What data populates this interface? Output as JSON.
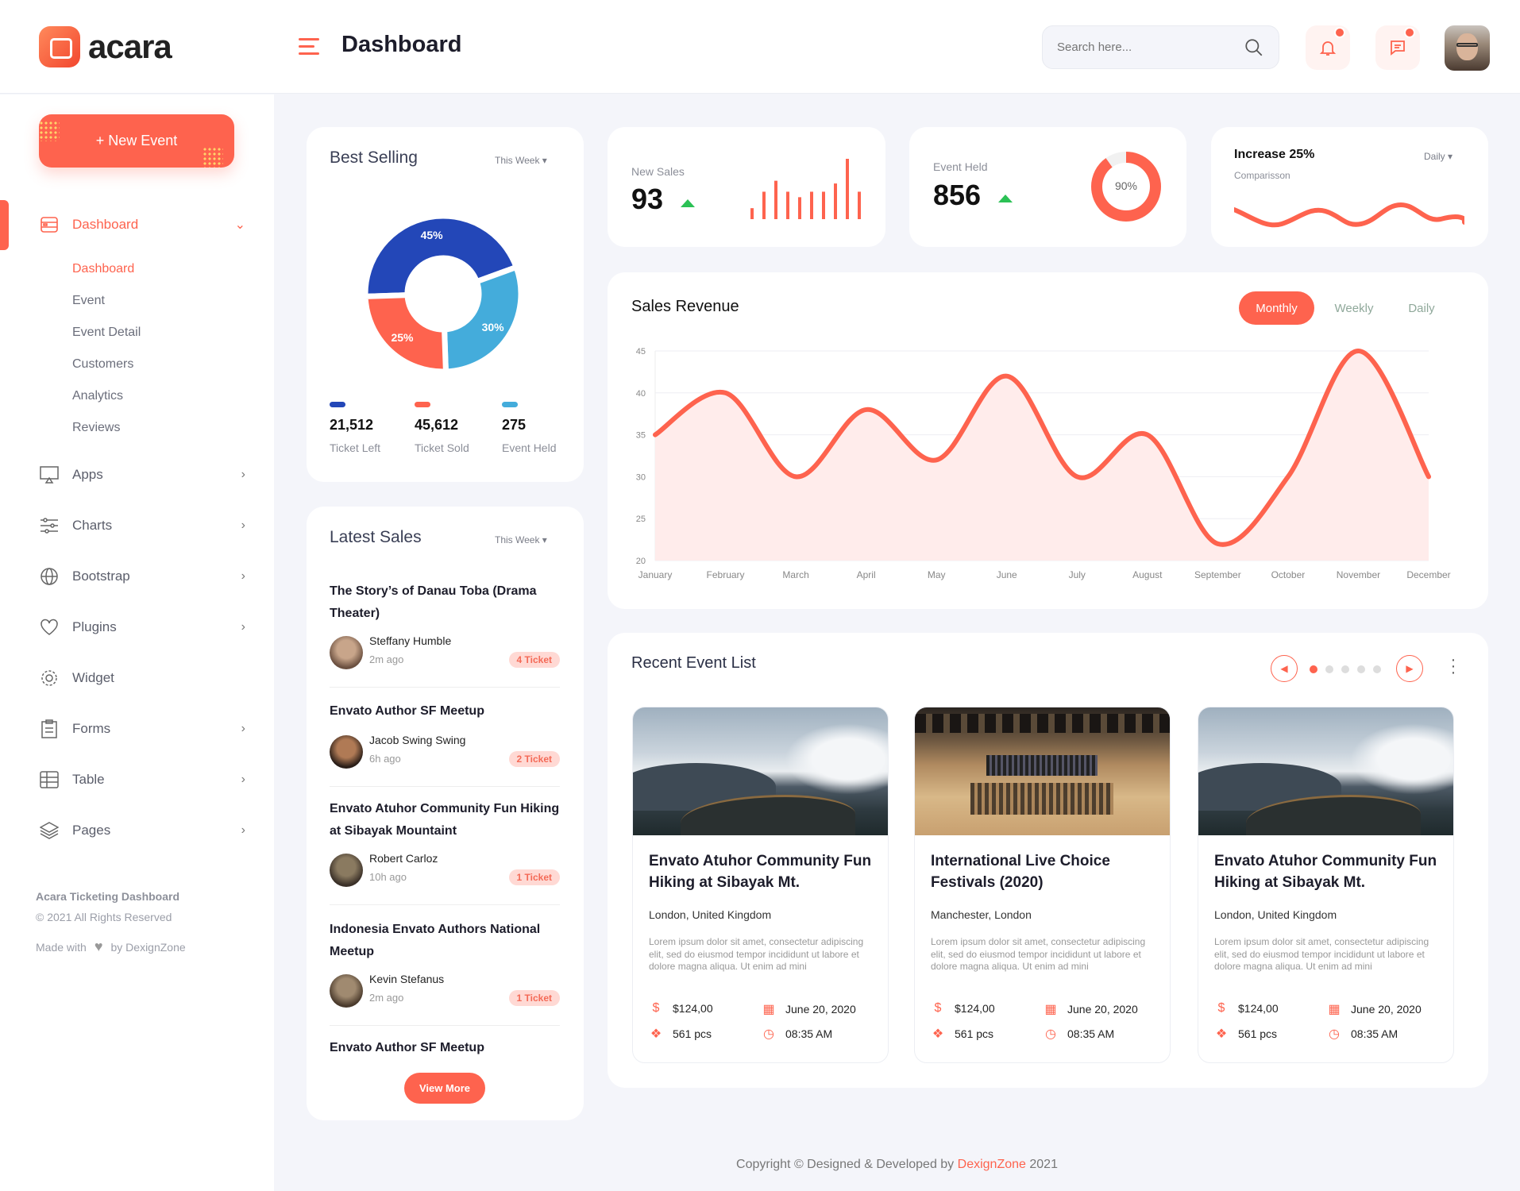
{
  "brand": {
    "name": "acara"
  },
  "header": {
    "title": "Dashboard",
    "search_placeholder": "Search here..."
  },
  "sidebar": {
    "new_event": "+ New Event",
    "dashboard_group": "Dashboard",
    "sub_items": [
      "Dashboard",
      "Event",
      "Event Detail",
      "Customers",
      "Analytics",
      "Reviews"
    ],
    "items": [
      {
        "label": "Apps",
        "icon": "monitor-icon"
      },
      {
        "label": "Charts",
        "icon": "sliders-icon"
      },
      {
        "label": "Bootstrap",
        "icon": "globe-icon"
      },
      {
        "label": "Plugins",
        "icon": "heart-icon"
      },
      {
        "label": "Widget",
        "icon": "gear-icon"
      },
      {
        "label": "Forms",
        "icon": "clipboard-icon"
      },
      {
        "label": "Table",
        "icon": "table-icon"
      },
      {
        "label": "Pages",
        "icon": "layers-icon"
      }
    ],
    "footer": {
      "title": "Acara Ticketing Dashboard",
      "rights": "© 2021 All Rights Reserved",
      "made_with": "Made with",
      "by": "by DexignZone"
    }
  },
  "best_selling": {
    "title": "Best Selling",
    "period": "This Week",
    "slices": [
      {
        "pct": 45,
        "label": "45%",
        "color": "#2347b8"
      },
      {
        "pct": 30,
        "label": "30%",
        "color": "#44acdb"
      },
      {
        "pct": 25,
        "label": "25%",
        "color": "#fe634e"
      }
    ],
    "stats": [
      {
        "value": "21,512",
        "label": "Ticket Left",
        "color": "#2347b8"
      },
      {
        "value": "45,612",
        "label": "Ticket Sold",
        "color": "#fe634e"
      },
      {
        "value": "275",
        "label": "Event Held",
        "color": "#44acdb"
      }
    ]
  },
  "new_sales": {
    "label": "New Sales",
    "value": "93",
    "bars": [
      4,
      10,
      14,
      10,
      8,
      10,
      10,
      13,
      22,
      10
    ]
  },
  "event_held": {
    "label": "Event Held",
    "value": "856",
    "percent": 90,
    "percent_label": "90%"
  },
  "increase": {
    "title": "Increase 25%",
    "subtitle": "Comparisson",
    "period": "Daily"
  },
  "sales_revenue": {
    "title": "Sales Revenue",
    "tabs": [
      "Monthly",
      "Weekly",
      "Daily"
    ],
    "active_tab": "Monthly"
  },
  "chart_data": {
    "type": "area",
    "categories": [
      "January",
      "February",
      "March",
      "April",
      "May",
      "June",
      "July",
      "August",
      "September",
      "October",
      "November",
      "December"
    ],
    "values": [
      35,
      40,
      30,
      38,
      32,
      42,
      30,
      35,
      22,
      30,
      45,
      30
    ],
    "ylim": [
      20,
      45
    ],
    "yticks": [
      20,
      25,
      30,
      35,
      40,
      45
    ],
    "grid": true,
    "color": "#fe634e"
  },
  "latest_sales": {
    "title": "Latest Sales",
    "period": "This Week",
    "items": [
      {
        "title": "The Story’s of Danau Toba (Drama Theater)",
        "name": "Steffany Humble",
        "time": "2m ago",
        "tickets": "4 Ticket"
      },
      {
        "title": "Envato Author SF Meetup",
        "name": "Jacob Swing Swing",
        "time": "6h ago",
        "tickets": "2 Ticket"
      },
      {
        "title": "Envato Atuhor Community Fun Hiking at Sibayak Mountaint",
        "name": "Robert Carloz",
        "time": "10h ago",
        "tickets": "1 Ticket"
      },
      {
        "title": "Indonesia Envato Authors National Meetup",
        "name": "Kevin Stefanus",
        "time": "2m ago",
        "tickets": "1 Ticket"
      }
    ],
    "last_title": "Envato Author SF Meetup",
    "view_more": "View More"
  },
  "recent_events": {
    "title": "Recent Event List",
    "events": [
      {
        "title": "Envato Atuhor Community Fun Hiking at Sibayak Mt.",
        "location": "London, United Kingdom",
        "desc": "Lorem ipsum dolor sit amet, consectetur adipiscing elit, sed do eiusmod tempor incididunt ut labore et dolore magna aliqua. Ut enim ad mini",
        "price": "$124,00",
        "date": "June 20, 2020",
        "pcs": "561 pcs",
        "time": "08:35 AM",
        "image": "mountain"
      },
      {
        "title": "International Live Choice Festivals (2020)",
        "location": "Manchester, London",
        "desc": "Lorem ipsum dolor sit amet, consectetur adipiscing elit, sed do eiusmod tempor incididunt ut labore et dolore magna aliqua. Ut enim ad mini",
        "price": "$124,00",
        "date": "June 20, 2020",
        "pcs": "561 pcs",
        "time": "08:35 AM",
        "image": "concert-hall"
      },
      {
        "title": "Envato Atuhor Community Fun Hiking at Sibayak Mt.",
        "location": "London, United Kingdom",
        "desc": "Lorem ipsum dolor sit amet, consectetur adipiscing elit, sed do eiusmod tempor incididunt ut labore et dolore magna aliqua. Ut enim ad mini",
        "price": "$124,00",
        "date": "June 20, 2020",
        "pcs": "561 pcs",
        "time": "08:35 AM",
        "image": "mountain"
      }
    ]
  },
  "footer": {
    "prefix": "Copyright © Designed & Developed by",
    "brand": "DexignZone",
    "year": "2021"
  },
  "colors": {
    "accent": "#fe634e",
    "success": "#2bc155"
  }
}
